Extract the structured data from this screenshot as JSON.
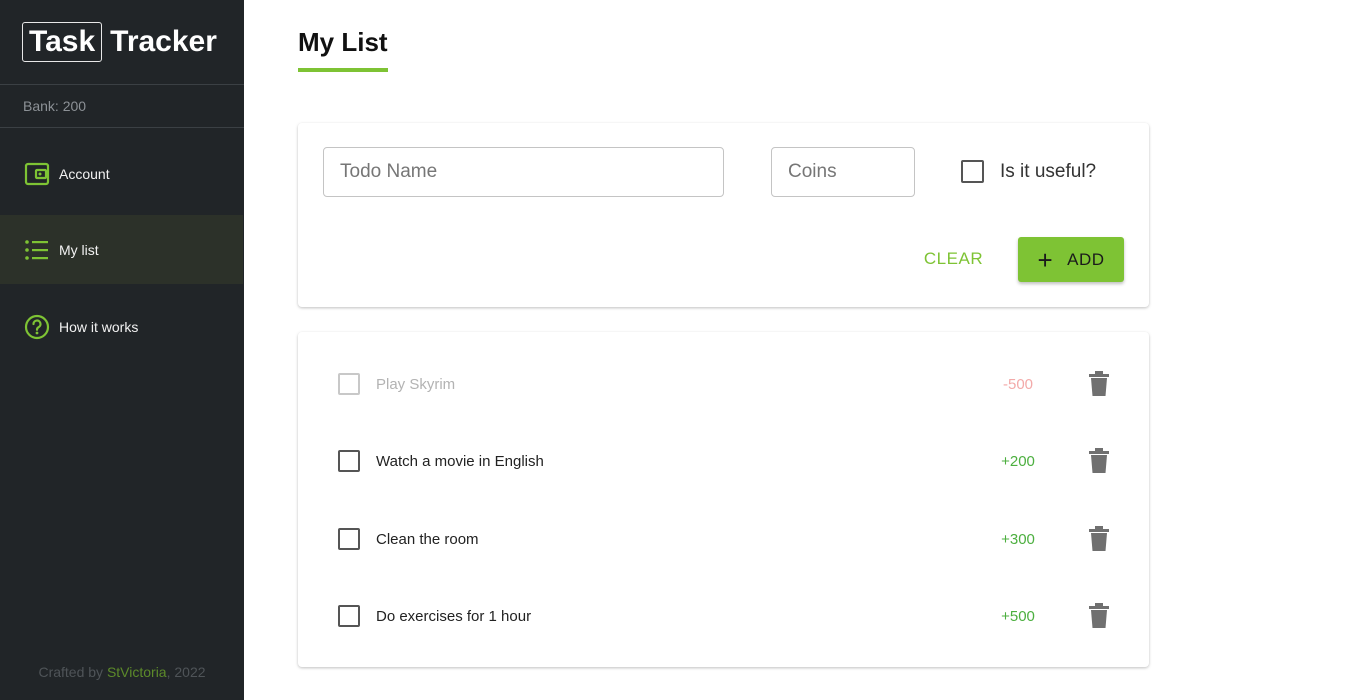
{
  "app": {
    "logo_box": "Task",
    "logo_rest": "Tracker",
    "bank": "Bank: 200"
  },
  "nav": [
    {
      "label": "Account",
      "icon": "wallet-icon",
      "active": false
    },
    {
      "label": "My list",
      "icon": "list-icon",
      "active": true
    },
    {
      "label": "How it works",
      "icon": "question-circle-icon",
      "active": false
    }
  ],
  "footer": {
    "prefix": "Crafted by ",
    "author": "StVictoria",
    "suffix": ", 2022"
  },
  "page": {
    "title": "My List"
  },
  "form": {
    "todo_placeholder": "Todo Name",
    "coins_placeholder": "Coins",
    "useful_label": "Is it useful?",
    "clear_label": "CLEAR",
    "add_label": "ADD"
  },
  "todos": [
    {
      "name": "Play Skyrim",
      "coins": "-500",
      "done": true
    },
    {
      "name": "Watch a movie in English",
      "coins": "+200",
      "done": false
    },
    {
      "name": "Clean the room",
      "coins": "+300",
      "done": false
    },
    {
      "name": "Do exercises for 1 hour",
      "coins": "+500",
      "done": false
    }
  ],
  "colors": {
    "accent": "#7ec334",
    "sidebar": "#212528",
    "positive": "#4caf3f",
    "negative": "#f3aaa9"
  }
}
